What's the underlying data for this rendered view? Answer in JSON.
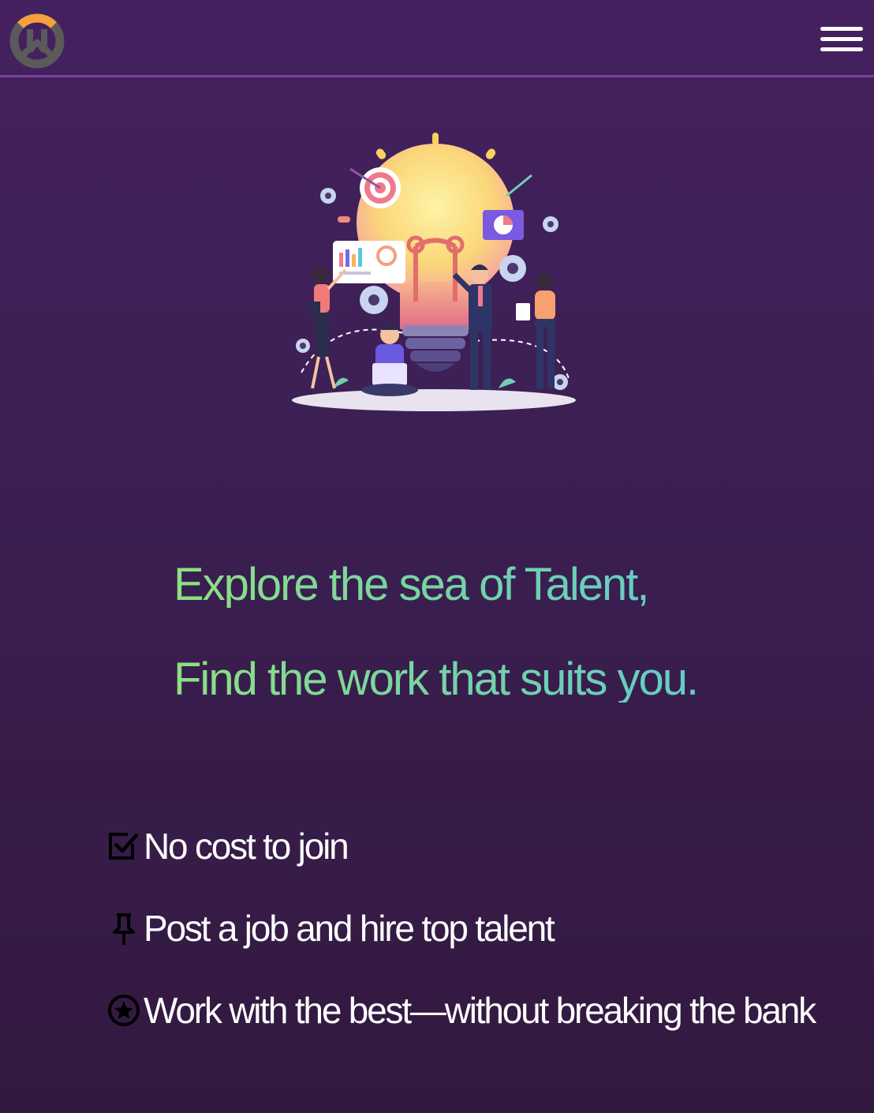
{
  "header": {
    "logo_icon": "overwatch-style-logo-icon",
    "menu_icon": "hamburger-menu-icon"
  },
  "hero": {
    "illustration": "lightbulb-team-innovation-illustration",
    "headline_line1": "Explore the sea of Talent,",
    "headline_line2": "Find the work that suits you.",
    "gradient_colors": [
      "#8ee081",
      "#5ec7d6"
    ]
  },
  "features": [
    {
      "icon": "checkbox-checked-icon",
      "text": "No cost to join"
    },
    {
      "icon": "pushpin-icon",
      "text": "Post a job and hire top talent"
    },
    {
      "icon": "star-circle-icon",
      "text": "Work with the best—without breaking the bank"
    }
  ],
  "colors": {
    "background_top": "#44215f",
    "background_bottom": "#32193f",
    "nav_border": "#7a3f9a",
    "logo_orange": "#f4a03c",
    "logo_grey": "#5a5a5a"
  }
}
